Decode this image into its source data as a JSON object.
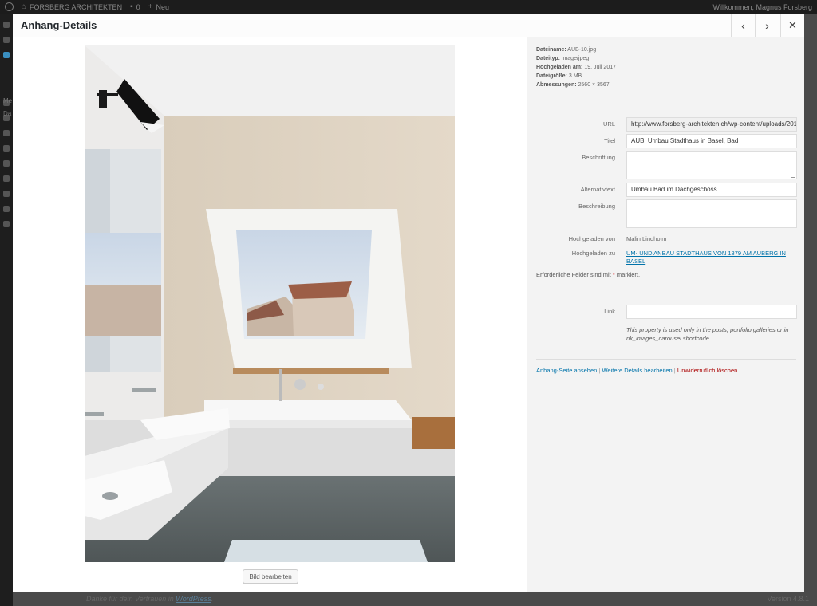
{
  "admin_bar": {
    "site_name": "FORSBERG ARCHITEKTEN",
    "comments_count": "0",
    "new_label": "Neu",
    "greeting": "Willkommen, Magnus Forsberg"
  },
  "admin_menu": {
    "item_me": "Me",
    "item_da": "Da"
  },
  "footer": {
    "thanks_text": "Danke für dein Vertrauen in",
    "thanks_link": "WordPress",
    "version": "Version 4.8.1"
  },
  "modal": {
    "title": "Anhang-Details",
    "prev_glyph": "‹",
    "next_glyph": "›",
    "close_glyph": "✕",
    "edit_image_label": "Bild bearbeiten"
  },
  "file_info": {
    "filename_label": "Dateiname:",
    "filename": "AUB-10.jpg",
    "filetype_label": "Dateityp:",
    "filetype": "image/jpeg",
    "uploaded_label": "Hochgeladen am:",
    "uploaded": "19. Juli 2017",
    "size_label": "Dateigröße:",
    "size": "3 MB",
    "dims_label": "Abmessungen:",
    "dims": "2560 × 3567"
  },
  "fields": {
    "url_label": "URL",
    "url_value": "http://www.forsberg-architekten.ch/wp-content/uploads/2017/07/AUB-10.jpg",
    "title_label": "Titel",
    "title_value": "AUB: Umbau Stadthaus in Basel, Bad",
    "caption_label": "Beschriftung",
    "caption_value": "",
    "alt_label": "Alternativtext",
    "alt_value": "Umbau Bad im Dachgeschoss",
    "desc_label": "Beschreibung",
    "desc_value": "",
    "uploaded_by_label": "Hochgeladen von",
    "uploaded_by": "Malin Lindholm",
    "uploaded_to_label": "Hochgeladen zu",
    "uploaded_to": "UM- UND ANBAU STADTHAUS VON 1879 AM AUBERG IN BASEL",
    "required_text": "Erforderliche Felder sind mit",
    "required_star": "*",
    "required_suffix": "markiert.",
    "link_label": "Link",
    "link_value": "",
    "link_note": "This property is used only in the posts, portfolio galleries or in nk_images_carousel shortcode"
  },
  "actions": {
    "view_page": "Anhang-Seite ansehen",
    "sep1": "|",
    "edit_more": "Weitere Details bearbeiten",
    "sep2": "|",
    "delete": "Unwiderruflich löschen"
  }
}
